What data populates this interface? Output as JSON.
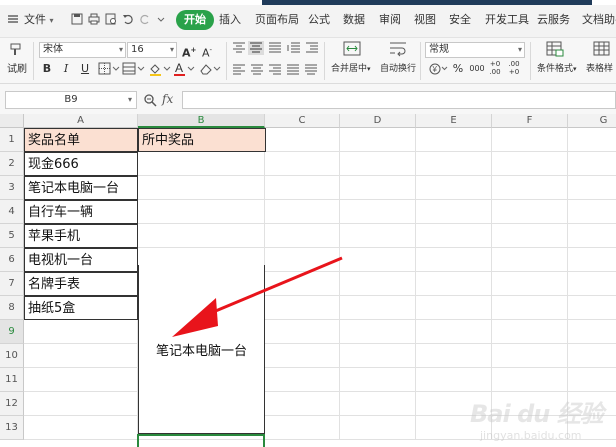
{
  "menu": {
    "file_label": "文件",
    "tabs": [
      "开始",
      "插入",
      "页面布局",
      "公式",
      "数据",
      "审阅",
      "视图",
      "安全",
      "开发工具",
      "云服务",
      "文档助手"
    ]
  },
  "ribbon": {
    "format_painter_label": "试刷",
    "font_name": "宋体",
    "font_size": "16",
    "grow_font": "A⁺",
    "shrink_font": "A⁻",
    "bold": "B",
    "italic": "I",
    "underline": "U",
    "merge_label": "合并居中",
    "wrap_label": "自动换行",
    "number_format": "常规",
    "percent": "%",
    "thousands": "000",
    "inc_decimal": "+0 .00",
    "dec_decimal": ".00 +0",
    "cond_format_label": "条件格式",
    "table_style_label": "表格样"
  },
  "formula_bar": {
    "cell_ref": "B9",
    "fx": "fx",
    "value": ""
  },
  "columns": [
    "A",
    "B",
    "C",
    "D",
    "E",
    "F",
    "G"
  ],
  "rows": [
    "1",
    "2",
    "3",
    "4",
    "5",
    "6",
    "7",
    "8",
    "9",
    "10",
    "11",
    "12",
    "13"
  ],
  "sheet": {
    "a1": "奖品名单",
    "b1": "所中奖品",
    "a_list": [
      "现金666",
      "笔记本电脑一台",
      "自行车一辆",
      "苹果手机",
      "电视机一台",
      "名牌手表",
      "抽纸5盒"
    ],
    "b_merged": "笔记本电脑一台"
  },
  "watermark": {
    "brand": "Bai du 经验",
    "url": "jingyan.baidu.com"
  },
  "colors": {
    "header_fill": "#fbe0d2",
    "active_tab": "#2aa24a",
    "selection": "#2a8a3e",
    "arrow": "#e8141b"
  }
}
